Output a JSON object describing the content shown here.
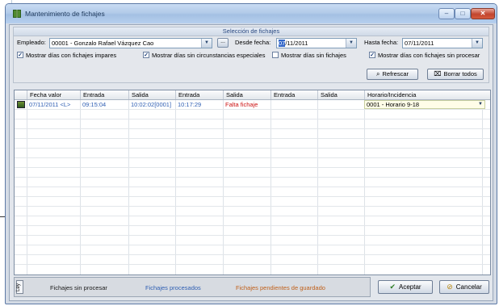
{
  "window": {
    "title": "Mantenimiento de fichajes",
    "buttons": {
      "minimize": "–",
      "maximize": "□",
      "close": "✕"
    }
  },
  "selection": {
    "header": "Selección de fichajes",
    "empleado_label": "Empleado:",
    "empleado_value": "00001 - Gonzalo Rafael Vázquez Cao",
    "browse_label": "...",
    "desde_label": "Desde fecha:",
    "desde_day": "07",
    "desde_rest": "/11/2011",
    "hasta_label": "Hasta fecha:",
    "hasta_value": "07/11/2011",
    "checks": [
      {
        "label": "Mostrar días con fichajes impares",
        "checked": true
      },
      {
        "label": "Mostrar días sin circunstancias especiales",
        "checked": true
      },
      {
        "label": "Mostrar días sin fichajes",
        "checked": false
      },
      {
        "label": "Mostrar días con fichajes sin procesar",
        "checked": true
      }
    ],
    "refresh_label": "Refrescar",
    "clear_label": "Borrar todos"
  },
  "grid": {
    "columns": [
      "Fecha valor",
      "Entrada",
      "Salida",
      "Entrada",
      "Salida",
      "Entrada",
      "Salida",
      "Horario/Incidencia"
    ],
    "rows": [
      {
        "fecha": "07/11/2011 <L>",
        "entrada1": "09:15:04",
        "salida1": "10:02:02[0001]",
        "entrada2": "10:17:29",
        "salida2": "Falta fichaje",
        "entrada3": "",
        "salida3": "",
        "horario": "0001 - Horario 9-18"
      }
    ]
  },
  "legend": {
    "tag": "Ley",
    "items": [
      {
        "label": "Fichajes sin procesar",
        "color": "#1a1a1a"
      },
      {
        "label": "Fichajes procesados",
        "color": "#2f5fb3"
      },
      {
        "label": "Fichajes pendientes de guardado",
        "color": "#c0601a"
      }
    ]
  },
  "footer": {
    "accept_label": "Aceptar",
    "cancel_label": "Cancelar"
  },
  "colors": {
    "processed": "#2f5fb3",
    "missing": "#cc1111",
    "pending": "#c0601a"
  }
}
